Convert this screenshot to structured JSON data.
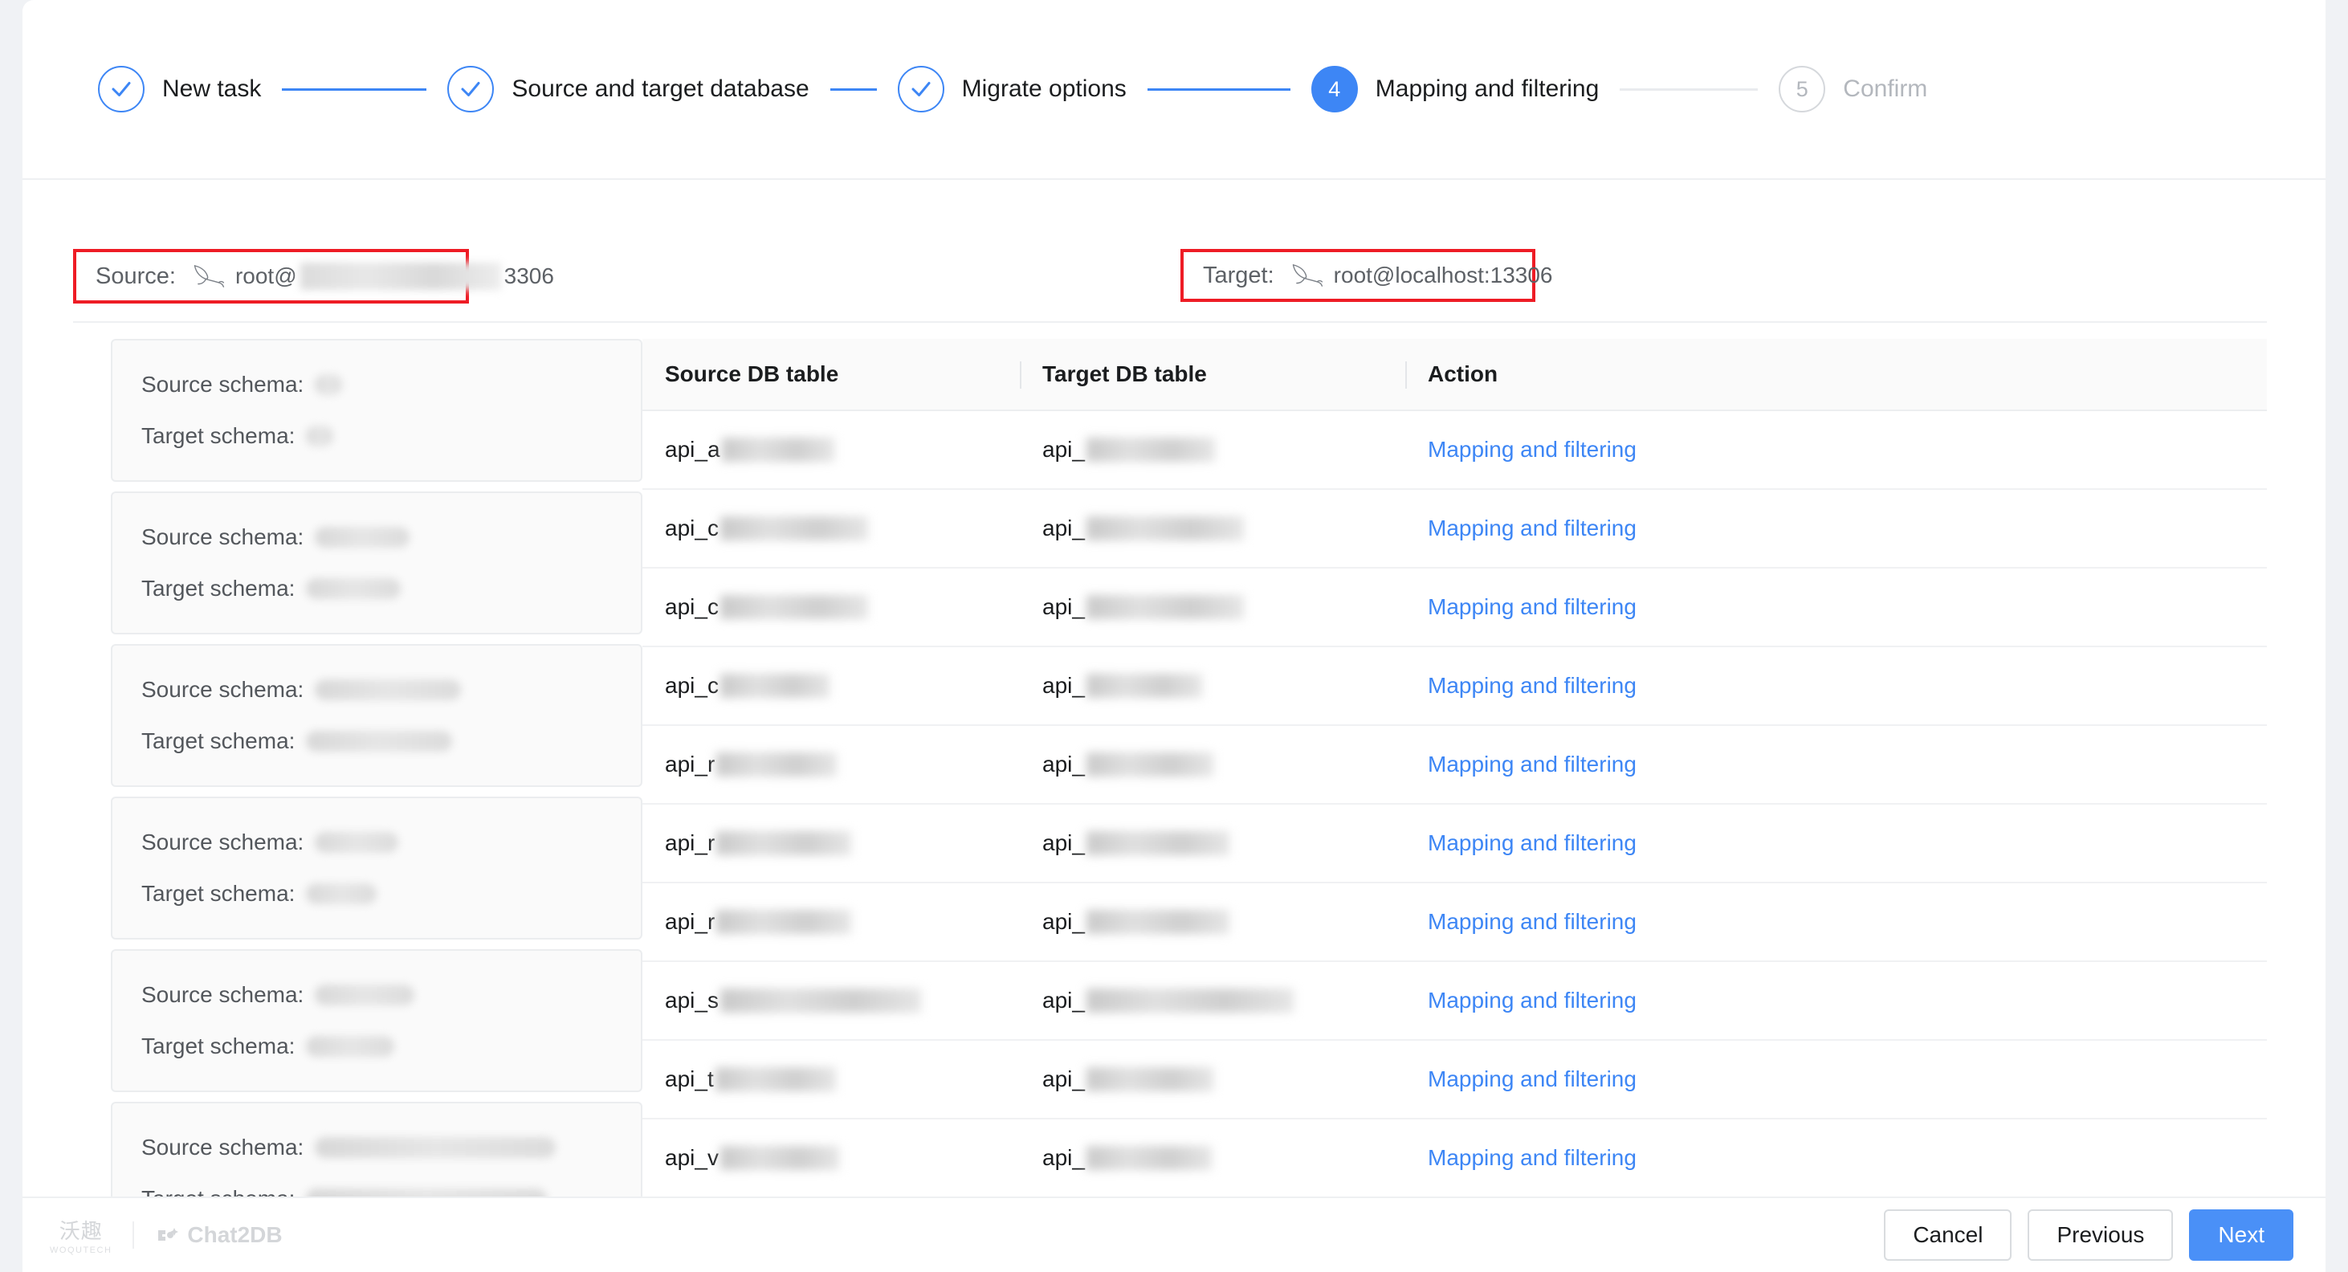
{
  "stepper": {
    "steps": [
      {
        "label": "New task",
        "state": "done",
        "icon": "check-icon"
      },
      {
        "label": "Source and target database",
        "state": "done",
        "icon": "check-icon"
      },
      {
        "label": "Migrate options",
        "state": "done",
        "icon": "check-icon"
      },
      {
        "label": "Mapping and filtering",
        "state": "active",
        "number": "4"
      },
      {
        "label": "Confirm",
        "state": "todo",
        "number": "5"
      }
    ],
    "active_color": "#3d86f5",
    "inactive_color": "#b3b7bd"
  },
  "connection": {
    "source": {
      "label": "Source:",
      "icon": "mysql-dolphin-icon",
      "user": "root@",
      "host_redacted": true,
      "port": "3306",
      "highlight_color": "#ee1c25"
    },
    "target": {
      "label": "Target:",
      "icon": "mysql-dolphin-icon",
      "value": "root@localhost:13306",
      "highlight_color": "#ee1c25"
    }
  },
  "schema_panel": {
    "source_label": "Source schema:",
    "target_label": "Target schema:",
    "cards": [
      {
        "source_width": 34,
        "target_width": 34
      },
      {
        "source_width": 118,
        "target_width": 118
      },
      {
        "source_width": 182,
        "target_width": 182
      },
      {
        "source_width": 104,
        "target_width": 88
      },
      {
        "source_width": 124,
        "target_width": 110
      },
      {
        "source_width": 300,
        "target_width": 300
      }
    ]
  },
  "table": {
    "columns": [
      "Source DB table",
      "Target DB table",
      "Action"
    ],
    "action_label": "Mapping and filtering",
    "action_color": "#3d86f5",
    "rows": [
      {
        "source_prefix": "api_a",
        "source_blur": 140,
        "target_prefix": "api_",
        "target_blur": 160
      },
      {
        "source_prefix": "api_c",
        "source_blur": 184,
        "target_prefix": "api_",
        "target_blur": 196
      },
      {
        "source_prefix": "api_c",
        "source_blur": 184,
        "target_prefix": "api_",
        "target_blur": 196
      },
      {
        "source_prefix": "api_c",
        "source_blur": 136,
        "target_prefix": "api_",
        "target_blur": 144
      },
      {
        "source_prefix": "api_r",
        "source_blur": 150,
        "target_prefix": "api_",
        "target_blur": 158
      },
      {
        "source_prefix": "api_r",
        "source_blur": 168,
        "target_prefix": "api_",
        "target_blur": 178
      },
      {
        "source_prefix": "api_r",
        "source_blur": 168,
        "target_prefix": "api_",
        "target_blur": 178
      },
      {
        "source_prefix": "api_s",
        "source_blur": 250,
        "target_prefix": "api_",
        "target_blur": 258
      },
      {
        "source_prefix": "api_t",
        "source_blur": 150,
        "target_prefix": "api_",
        "target_blur": 158
      },
      {
        "source_prefix": "api_v",
        "source_blur": 148,
        "target_prefix": "api_",
        "target_blur": 156
      }
    ]
  },
  "footer": {
    "brand_cn": "沃趣",
    "brand_en": "WOQUTECH",
    "brand_product": "Chat2DB",
    "buttons": {
      "cancel": "Cancel",
      "previous": "Previous",
      "next": "Next"
    }
  }
}
